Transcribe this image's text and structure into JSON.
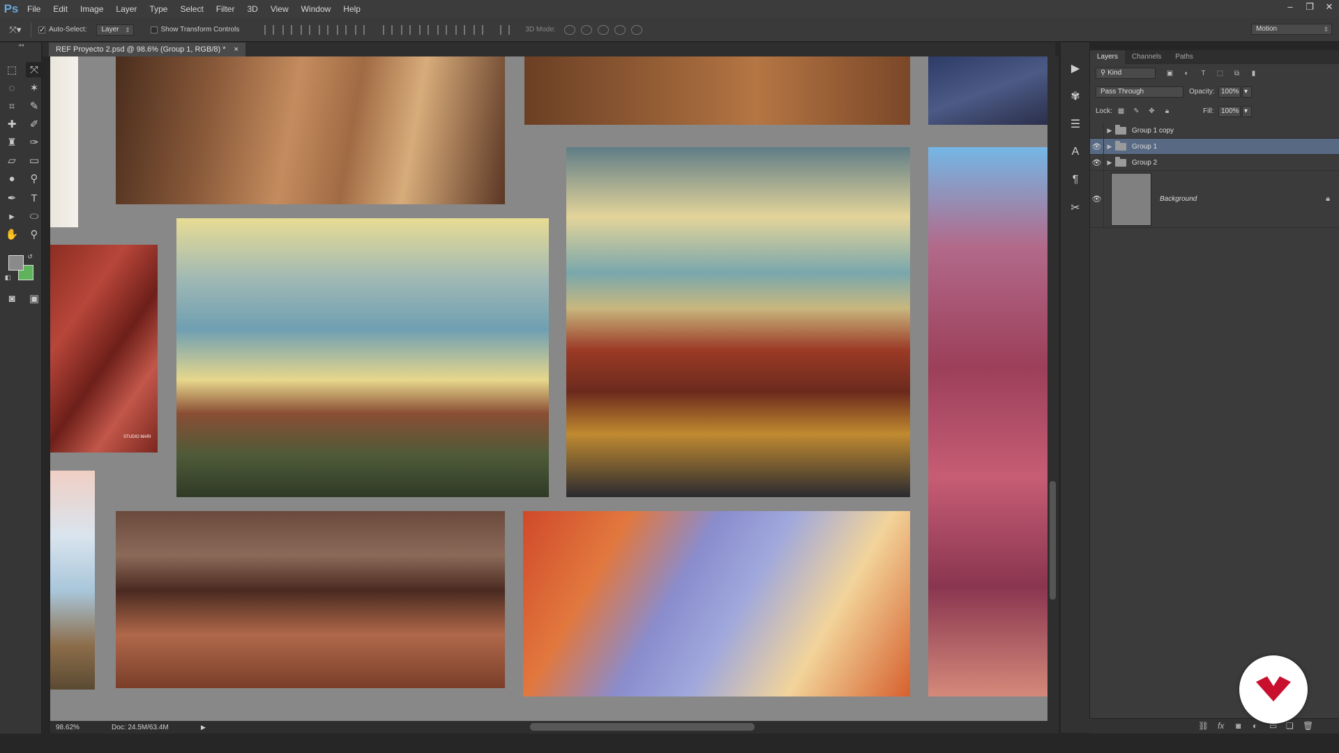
{
  "app": {
    "logo": "Ps"
  },
  "menu": [
    "File",
    "Edit",
    "Image",
    "Layer",
    "Type",
    "Select",
    "Filter",
    "3D",
    "View",
    "Window",
    "Help"
  ],
  "window_controls": [
    "–",
    "❐",
    "✕"
  ],
  "options": {
    "auto_select_label": "Auto-Select:",
    "auto_select_value": "Layer",
    "show_transform_label": "Show Transform Controls",
    "mode_3d_label": "3D Mode:",
    "workspace": "Motion"
  },
  "document": {
    "tab_title": "REF Proyecto 2.psd @ 98.6% (Group 1, RGB/8) *",
    "tab_close": "×",
    "zoom": "98.62%",
    "doc_size": "Doc: 24.5M/63.4M"
  },
  "canvas": {
    "watermark": "STUDIO MARI"
  },
  "layers_panel": {
    "tabs": [
      "Layers",
      "Channels",
      "Paths"
    ],
    "filter_kind": "Kind",
    "blend_mode": "Pass Through",
    "opacity_label": "Opacity:",
    "opacity_value": "100%",
    "lock_label": "Lock:",
    "fill_label": "Fill:",
    "fill_value": "100%",
    "layers": [
      {
        "name": "Group 1 copy",
        "visible": false,
        "selected": false
      },
      {
        "name": "Group 1",
        "visible": true,
        "selected": true
      },
      {
        "name": "Group 2",
        "visible": true,
        "selected": false
      }
    ],
    "background_layer": "Background"
  },
  "colors": {
    "selection": "#586983",
    "foreground_swatch": "#8a8a8a",
    "background_swatch": "#5fb35a",
    "badge_red": "#c8102e"
  }
}
